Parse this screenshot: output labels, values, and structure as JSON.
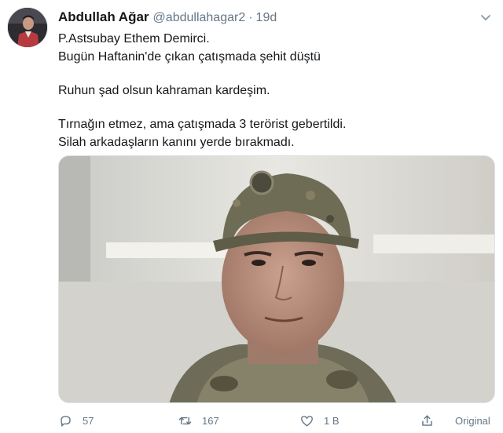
{
  "user": {
    "display_name": "Abdullah Ağar",
    "handle": "@abdullahagar2",
    "separator": "·",
    "time": "19d"
  },
  "tweet": {
    "lines": [
      "P.Astsubay Ethem Demirci.",
      "Bugün Haftanin'de çıkan çatışmada şehit düştü",
      "Ruhun şad olsun kahraman kardeşim.",
      "Tırnağın etmez, ama çatışmada 3 terörist gebertildi.",
      "Silah arkadaşların kanını yerde bırakmadı."
    ]
  },
  "actions": {
    "reply_count": "57",
    "retweet_count": "167",
    "like_count": "1 B",
    "original_label": "Original"
  },
  "icons": {
    "menu": "chevron-down-icon",
    "reply": "reply-icon",
    "retweet": "retweet-icon",
    "like": "heart-icon",
    "share": "share-icon"
  },
  "colors": {
    "text": "#14171a",
    "muted": "#657786",
    "border": "#e1e8ed"
  }
}
